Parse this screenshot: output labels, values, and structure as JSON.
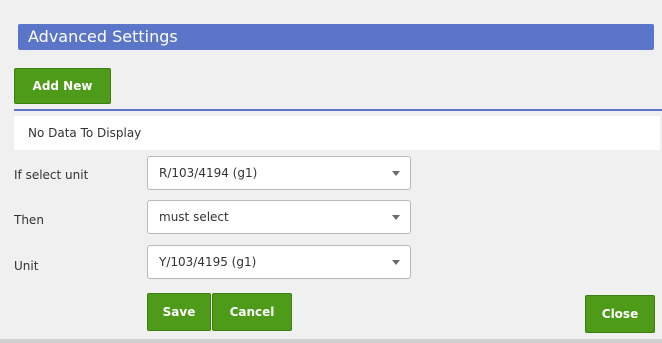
{
  "dialog": {
    "title": "Advanced Settings",
    "add_new_label": "Add New",
    "no_data_text": "No Data To Display",
    "fields": [
      {
        "label": "If select unit",
        "value": "R/103/4194 (g1)"
      },
      {
        "label": "Then",
        "value": "must select"
      },
      {
        "label": "Unit",
        "value": "Y/103/4195 (g1)"
      }
    ],
    "save_label": "Save",
    "cancel_label": "Cancel",
    "close_label": "Close"
  },
  "colors": {
    "title_bar": "#5b76c8",
    "button_green": "#4e9a19",
    "background": "#f0f0f0"
  },
  "icons": {
    "dropdown": "chevron-down-icon"
  }
}
